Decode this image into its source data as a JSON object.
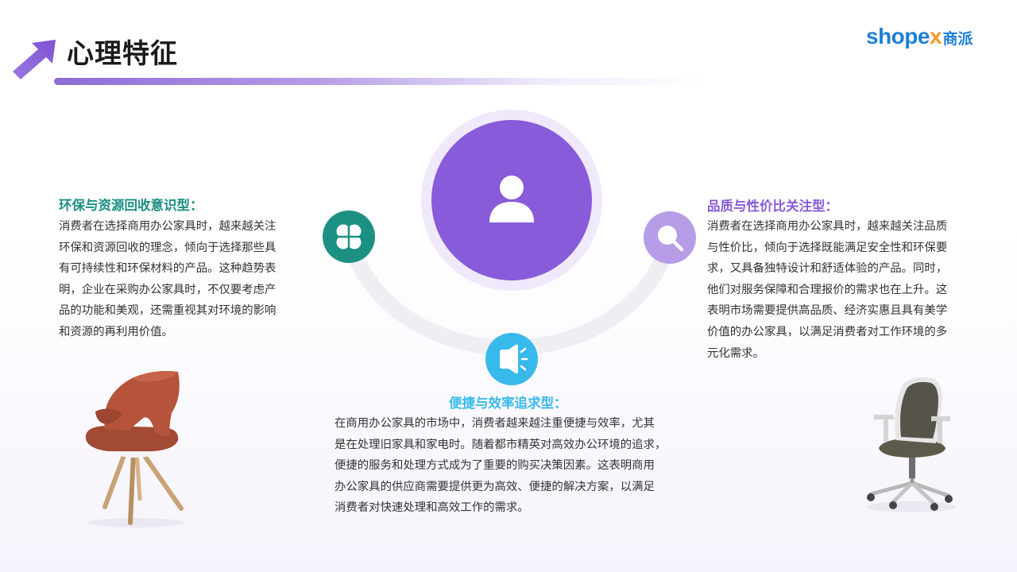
{
  "header": {
    "title": "心理特征",
    "icon": "arrow-up-left-icon"
  },
  "logo": {
    "brand_part1": "shope",
    "brand_x": "x",
    "brand_cn": "商派"
  },
  "center": {
    "icon": "person-icon",
    "color": "#875bd9"
  },
  "sections": {
    "eco": {
      "title": "环保与资源回收意识型：",
      "icon": "clover-icon",
      "color": "#1c9083",
      "lines": [
        "消费者在选择商用办公家具时，越来越关注",
        "环保和资源回收的理念，倾向于选择那些具",
        "有可持续性和环保材料的产品。这种趋势表",
        "明，企业在采购办公家具时，不仅要考虑产",
        "品的功能和美观，还需重视其对环境的影响",
        "和资源的再利用价值。"
      ]
    },
    "quality": {
      "title": "品质与性价比关注型：",
      "icon": "search-icon",
      "color": "#b79ce7",
      "lines": [
        "消费者在选择商用办公家具时，越来越关注品质",
        "与性价比，倾向于选择既能满足安全性和环保要",
        "求，又具备独特设计和舒适体验的产品。同时，",
        "他们对服务保障和合理报价的需求也在上升。这",
        "表明市场需要提供高品质、经济实惠且具有美学",
        "价值的办公家具，以满足消费者对工作环境的多",
        "元化需求。"
      ]
    },
    "convenience": {
      "title": "便捷与效率追求型：",
      "icon": "speaker-icon",
      "color": "#38b9ec",
      "lines": [
        "在商用办公家具的市场中，消费者越来越注重便捷与效率，尤其",
        "是在处理旧家具和家电时。随着都市精英对高效办公环境的追求，",
        "便捷的服务和处理方式成为了重要的购买决策因素。这表明商用",
        "办公家具的供应商需要提供更为高效、便捷的解决方案，以满足",
        "消费者对快速处理和高效工作的需求。"
      ]
    }
  }
}
